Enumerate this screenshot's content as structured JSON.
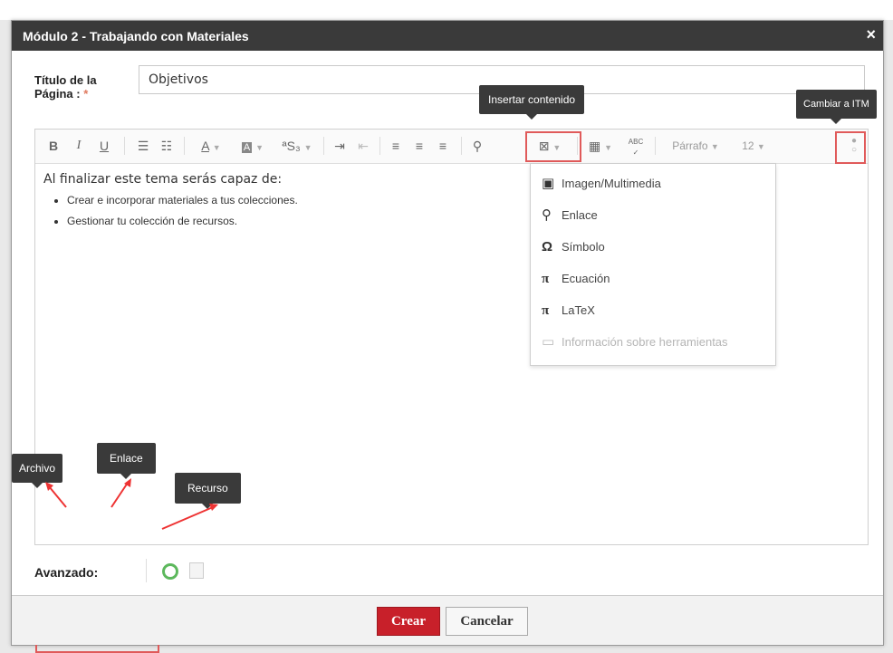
{
  "dialog": {
    "title": "Módulo 2 - Trabajando con Materiales",
    "close_label": "×"
  },
  "form": {
    "title_label_line1": "Título de la",
    "title_label_line2": "Página :",
    "required_mark": "*",
    "title_value": "Objetivos"
  },
  "toolbar": {
    "bold": "B",
    "italic": "I",
    "underline": "U",
    "paragraph_value": "Párrafo",
    "font_size_value": "12",
    "spellcheck_label": "ABC"
  },
  "content": {
    "intro": "Al finalizar este tema serás capaz de:",
    "bullets": [
      "Crear e incorporar materiales a tus colecciones.",
      "Gestionar tu colección de recursos."
    ]
  },
  "insert_menu": {
    "items": [
      {
        "icon": "image-icon",
        "label": "Imagen/Multimedia"
      },
      {
        "icon": "link-icon",
        "label": "Enlace"
      },
      {
        "icon": "omega-icon",
        "label": "Símbolo"
      },
      {
        "icon": "pi-icon",
        "label": "Ecuación"
      },
      {
        "icon": "pi-icon",
        "label": "LaTeX"
      },
      {
        "icon": "tooltip-icon",
        "label": "Información sobre herramientas"
      }
    ]
  },
  "tooltips": {
    "insert": "Insertar contenido",
    "switch": "Cambiar a ITM",
    "file": "Archivo",
    "link": "Enlace",
    "resource": "Recurso"
  },
  "advanced": {
    "label": "Avanzado:"
  },
  "footer": {
    "create_label": "Crear",
    "cancel_label": "Cancelar"
  },
  "colors": {
    "accent_red": "#c8202a",
    "annotation_red": "#e05a5a",
    "titlebar": "#3a3a3a",
    "toggle_green": "#5cb85c"
  }
}
